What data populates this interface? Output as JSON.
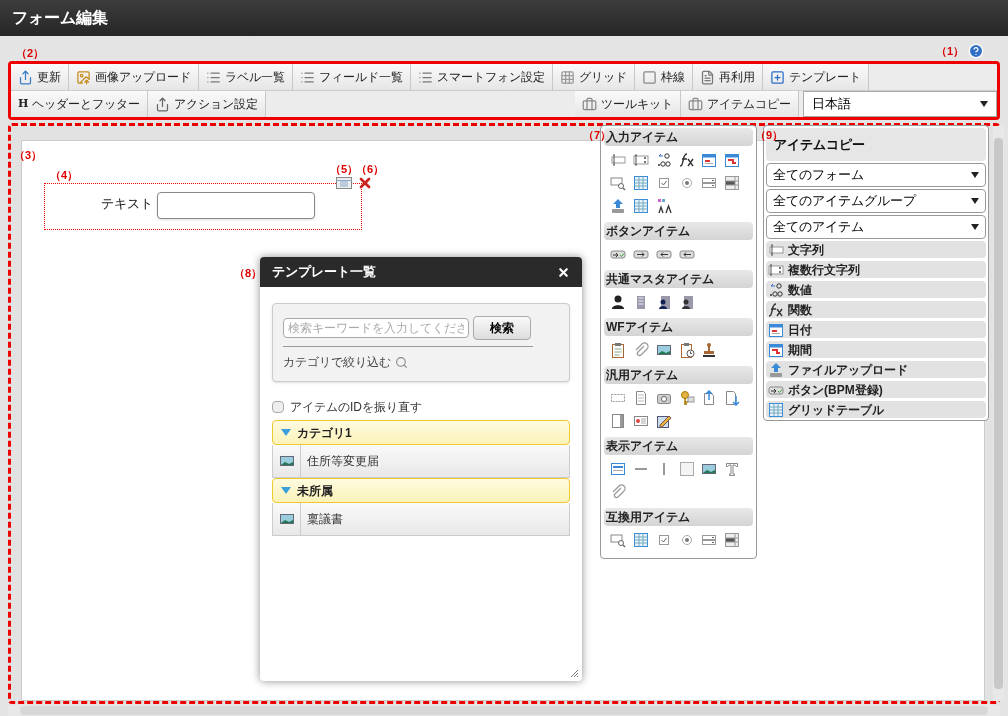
{
  "window": {
    "title": "フォーム編集"
  },
  "markers": {
    "help": "（1）",
    "toolbar": "（2）",
    "canvas": "（3）",
    "item": "（4）",
    "item_settings": "（5）",
    "item_delete": "（6）",
    "palette": "（7）",
    "template_dialog": "（8）",
    "item_copy": "（9）"
  },
  "toolbar": {
    "row_1": [
      {
        "label": "更新",
        "kind": "update"
      },
      {
        "label": "画像アップロード",
        "kind": "image-upload"
      },
      {
        "label": "ラベル一覧",
        "kind": "list"
      },
      {
        "label": "フィールド一覧",
        "kind": "list"
      },
      {
        "label": "スマートフォン設定",
        "kind": "list"
      },
      {
        "label": "グリッド",
        "kind": "grid"
      },
      {
        "label": "枠線",
        "kind": "border"
      },
      {
        "label": "再利用",
        "kind": "document"
      },
      {
        "label": "テンプレート",
        "kind": "template"
      }
    ],
    "row_2_left": [
      {
        "label": "ヘッダーとフッター",
        "kind": "glyph",
        "glyph": "H"
      },
      {
        "label": "アクション設定",
        "kind": "share"
      }
    ],
    "row_2_right": [
      {
        "label": "ツールキット",
        "kind": "toolbox"
      },
      {
        "label": "アイテムコピー",
        "kind": "toolbox"
      }
    ],
    "language": {
      "value": "日本語"
    }
  },
  "form_item": {
    "label": "テキスト"
  },
  "palette": [
    {
      "title": "入力アイテム",
      "icons": [
        {
          "kind": "text-field"
        },
        {
          "kind": "textarea"
        },
        {
          "kind": "number"
        },
        {
          "kind": "formula"
        },
        {
          "kind": "date"
        },
        {
          "kind": "period"
        },
        {
          "kind": "search-select"
        },
        {
          "kind": "grid"
        },
        {
          "kind": "checkbox"
        },
        {
          "kind": "radio"
        },
        {
          "kind": "list"
        },
        {
          "kind": "listbox"
        },
        {
          "kind": "upload"
        },
        {
          "kind": "grid"
        },
        {
          "kind": "style"
        }
      ]
    },
    {
      "title": "ボタンアイテム",
      "icons": [
        {
          "kind": "button-check"
        },
        {
          "kind": "button-next"
        },
        {
          "kind": "button-back"
        },
        {
          "kind": "button-back"
        }
      ]
    },
    {
      "title": "共通マスタアイテム",
      "icons": [
        {
          "kind": "person"
        },
        {
          "kind": "building"
        },
        {
          "kind": "org-person"
        },
        {
          "kind": "org-building"
        }
      ]
    },
    {
      "title": "WFアイテム",
      "icons": [
        {
          "kind": "clipboard"
        },
        {
          "kind": "paperclip"
        },
        {
          "kind": "image"
        },
        {
          "kind": "clipboard-clock"
        },
        {
          "kind": "stamp"
        }
      ]
    },
    {
      "title": "汎用アイテム",
      "icons": [
        {
          "kind": "dashed"
        },
        {
          "kind": "document"
        },
        {
          "kind": "photo"
        },
        {
          "kind": "key"
        },
        {
          "kind": "upload-doc"
        },
        {
          "kind": "download-doc"
        },
        {
          "kind": "panel"
        },
        {
          "kind": "card"
        },
        {
          "kind": "edit"
        }
      ]
    },
    {
      "title": "表示アイテム",
      "icons": [
        {
          "kind": "label-block"
        },
        {
          "kind": "hline"
        },
        {
          "kind": "vline"
        },
        {
          "kind": "square"
        },
        {
          "kind": "image"
        },
        {
          "kind": "text-style"
        },
        {
          "kind": "paperclip"
        }
      ]
    },
    {
      "title": "互換用アイテム",
      "icons": [
        {
          "kind": "search-select"
        },
        {
          "kind": "grid"
        },
        {
          "kind": "checkbox"
        },
        {
          "kind": "radio"
        },
        {
          "kind": "list"
        },
        {
          "kind": "listbox"
        }
      ]
    }
  ],
  "item_copy": {
    "title": "アイテムコピー",
    "filters": [
      "全てのフォーム",
      "全てのアイテムグループ",
      "全てのアイテム"
    ],
    "items": [
      {
        "label": "文字列",
        "kind": "text-field"
      },
      {
        "label": "複数行文字列",
        "kind": "textarea"
      },
      {
        "label": "数値",
        "kind": "number"
      },
      {
        "label": "関数",
        "kind": "formula"
      },
      {
        "label": "日付",
        "kind": "date"
      },
      {
        "label": "期間",
        "kind": "period"
      },
      {
        "label": "ファイルアップロード",
        "kind": "upload"
      },
      {
        "label": "ボタン(BPM登録)",
        "kind": "button-check"
      },
      {
        "label": "グリッドテーブル",
        "kind": "grid"
      }
    ]
  },
  "template_dialog": {
    "title": "テンプレート一覧",
    "search": {
      "placeholder": "検索キーワードを入力してくださ",
      "button": "検索"
    },
    "filter_link": "カテゴリで絞り込む",
    "renumber": {
      "label": "アイテムのIDを振り直す",
      "checked": false
    },
    "categories": [
      {
        "name": "カテゴリ1",
        "expanded": true,
        "children": [
          {
            "name": "住所等変更届"
          }
        ]
      },
      {
        "name": "未所属",
        "expanded": true,
        "children": [
          {
            "name": "稟議書"
          }
        ]
      }
    ]
  }
}
